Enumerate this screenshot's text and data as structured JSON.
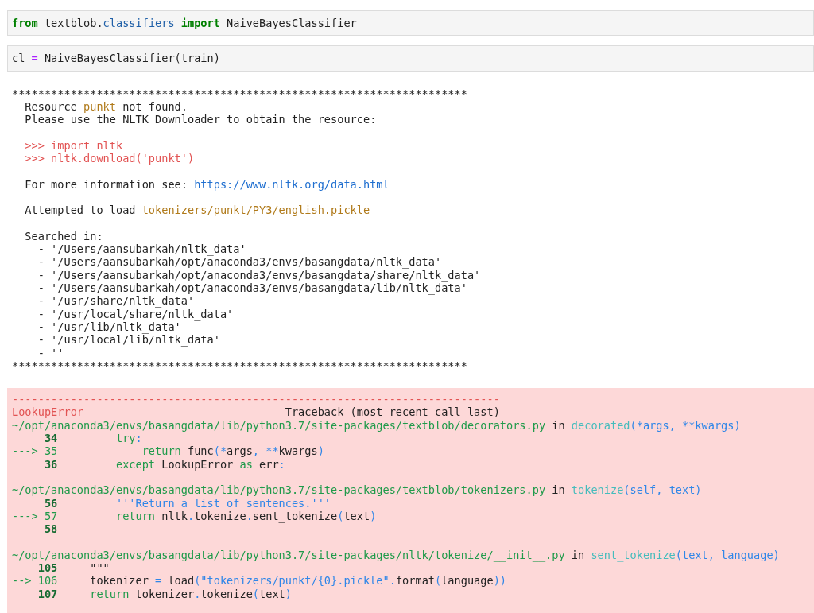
{
  "cells": [
    {
      "kind": "input",
      "lines": [
        {
          "kind": "code",
          "tokens": [
            {
              "text": "from",
              "kind": "keyword"
            },
            {
              "text": " textblob.",
              "kind": "plain"
            },
            {
              "text": "classifiers",
              "kind": "module"
            },
            {
              "text": " import",
              "kind": "keyword"
            },
            {
              "text": " NaiveBayesClassifier",
              "kind": "plain"
            }
          ]
        }
      ]
    },
    {
      "kind": "input",
      "lines": [
        {
          "kind": "code",
          "tokens": [
            {
              "text": "cl ",
              "kind": "plain"
            },
            {
              "text": "=",
              "kind": "operator"
            },
            {
              "text": " NaiveBayesClassifier(train)",
              "kind": "plain"
            }
          ]
        }
      ]
    },
    {
      "kind": "output",
      "lines": [
        {
          "kind": "code",
          "tokens": [
            {
              "text": "**********************************************************************",
              "kind": "plain"
            }
          ]
        },
        {
          "kind": "code",
          "tokens": [
            {
              "text": "  Resource ",
              "kind": "plain"
            },
            {
              "text": "punkt",
              "kind": "string"
            },
            {
              "text": " not found.",
              "kind": "plain"
            }
          ]
        },
        {
          "kind": "code",
          "tokens": [
            {
              "text": "  Please use the NLTK Downloader to obtain the resource:",
              "kind": "plain"
            }
          ]
        },
        {
          "kind": "blank"
        },
        {
          "kind": "code",
          "tokens": [
            {
              "text": "  >>> import nltk",
              "kind": "red"
            }
          ]
        },
        {
          "kind": "code",
          "tokens": [
            {
              "text": "  >>> nltk.download('punkt')",
              "kind": "red"
            }
          ]
        },
        {
          "kind": "blank"
        },
        {
          "kind": "code",
          "tokens": [
            {
              "text": "  For more information see: ",
              "kind": "plain"
            },
            {
              "text": "https://www.nltk.org/data.html",
              "kind": "link"
            }
          ]
        },
        {
          "kind": "blank"
        },
        {
          "kind": "code",
          "tokens": [
            {
              "text": "  Attempted to load ",
              "kind": "plain"
            },
            {
              "text": "tokenizers/punkt/PY3/english.pickle",
              "kind": "string"
            }
          ]
        },
        {
          "kind": "blank"
        },
        {
          "kind": "code",
          "tokens": [
            {
              "text": "  Searched in:",
              "kind": "plain"
            }
          ]
        },
        {
          "kind": "code",
          "tokens": [
            {
              "text": "    - '/Users/aansubarkah/nltk_data'",
              "kind": "plain"
            }
          ]
        },
        {
          "kind": "code",
          "tokens": [
            {
              "text": "    - '/Users/aansubarkah/opt/anaconda3/envs/basangdata/nltk_data'",
              "kind": "plain"
            }
          ]
        },
        {
          "kind": "code",
          "tokens": [
            {
              "text": "    - '/Users/aansubarkah/opt/anaconda3/envs/basangdata/share/nltk_data'",
              "kind": "plain"
            }
          ]
        },
        {
          "kind": "code",
          "tokens": [
            {
              "text": "    - '/Users/aansubarkah/opt/anaconda3/envs/basangdata/lib/nltk_data'",
              "kind": "plain"
            }
          ]
        },
        {
          "kind": "code",
          "tokens": [
            {
              "text": "    - '/usr/share/nltk_data'",
              "kind": "plain"
            }
          ]
        },
        {
          "kind": "code",
          "tokens": [
            {
              "text": "    - '/usr/local/share/nltk_data'",
              "kind": "plain"
            }
          ]
        },
        {
          "kind": "code",
          "tokens": [
            {
              "text": "    - '/usr/lib/nltk_data'",
              "kind": "plain"
            }
          ]
        },
        {
          "kind": "code",
          "tokens": [
            {
              "text": "    - '/usr/local/lib/nltk_data'",
              "kind": "plain"
            }
          ]
        },
        {
          "kind": "code",
          "tokens": [
            {
              "text": "    - ''",
              "kind": "plain"
            }
          ]
        },
        {
          "kind": "code",
          "tokens": [
            {
              "text": "**********************************************************************",
              "kind": "plain"
            }
          ]
        }
      ]
    },
    {
      "kind": "error",
      "lines": [
        {
          "kind": "code",
          "tokens": [
            {
              "text": "---------------------------------------------------------------------------",
              "kind": "red"
            }
          ]
        },
        {
          "kind": "code",
          "tokens": [
            {
              "text": "LookupError",
              "kind": "red"
            },
            {
              "text": "                               Traceback (most recent call last)",
              "kind": "plain"
            }
          ]
        },
        {
          "kind": "code",
          "tokens": [
            {
              "text": "~/opt/anaconda3/envs/basangdata/lib/python3.7/site-packages/textblob/decorators.py",
              "kind": "path"
            },
            {
              "text": " in ",
              "kind": "plain"
            },
            {
              "text": "decorated",
              "kind": "function"
            },
            {
              "text": "(*args, **kwargs)",
              "kind": "param"
            }
          ]
        },
        {
          "kind": "code",
          "tokens": [
            {
              "text": "     34",
              "kind": "lineno"
            },
            {
              "text": "         try",
              "kind": "path"
            },
            {
              "text": ":",
              "kind": "param"
            }
          ]
        },
        {
          "kind": "code",
          "tokens": [
            {
              "text": "---> 35",
              "kind": "path"
            },
            {
              "text": "             return",
              "kind": "path"
            },
            {
              "text": " func",
              "kind": "plain"
            },
            {
              "text": "(*",
              "kind": "param"
            },
            {
              "text": "args",
              "kind": "plain"
            },
            {
              "text": ", **",
              "kind": "param"
            },
            {
              "text": "kwargs",
              "kind": "plain"
            },
            {
              "text": ")",
              "kind": "param"
            }
          ]
        },
        {
          "kind": "code",
          "tokens": [
            {
              "text": "     36",
              "kind": "lineno"
            },
            {
              "text": "         except",
              "kind": "path"
            },
            {
              "text": " LookupError ",
              "kind": "plain"
            },
            {
              "text": "as",
              "kind": "path"
            },
            {
              "text": " err",
              "kind": "plain"
            },
            {
              "text": ":",
              "kind": "param"
            }
          ]
        },
        {
          "kind": "blank"
        },
        {
          "kind": "code",
          "tokens": [
            {
              "text": "~/opt/anaconda3/envs/basangdata/lib/python3.7/site-packages/textblob/tokenizers.py",
              "kind": "path"
            },
            {
              "text": " in ",
              "kind": "plain"
            },
            {
              "text": "tokenize",
              "kind": "function"
            },
            {
              "text": "(self, text)",
              "kind": "param"
            }
          ]
        },
        {
          "kind": "code",
          "tokens": [
            {
              "text": "     56",
              "kind": "lineno"
            },
            {
              "text": "         '''Return a list of sentences.'''",
              "kind": "param"
            }
          ]
        },
        {
          "kind": "code",
          "tokens": [
            {
              "text": "---> 57",
              "kind": "path"
            },
            {
              "text": "         return",
              "kind": "path"
            },
            {
              "text": " nltk",
              "kind": "plain"
            },
            {
              "text": ".",
              "kind": "param"
            },
            {
              "text": "tokenize",
              "kind": "plain"
            },
            {
              "text": ".",
              "kind": "param"
            },
            {
              "text": "sent_tokenize",
              "kind": "plain"
            },
            {
              "text": "(",
              "kind": "param"
            },
            {
              "text": "text",
              "kind": "plain"
            },
            {
              "text": ")",
              "kind": "param"
            }
          ]
        },
        {
          "kind": "code",
          "tokens": [
            {
              "text": "     58",
              "kind": "lineno"
            }
          ]
        },
        {
          "kind": "blank"
        },
        {
          "kind": "code",
          "tokens": [
            {
              "text": "~/opt/anaconda3/envs/basangdata/lib/python3.7/site-packages/nltk/tokenize/__init__.py",
              "kind": "path"
            },
            {
              "text": " in ",
              "kind": "plain"
            },
            {
              "text": "sent_tokenize",
              "kind": "function"
            },
            {
              "text": "(text, language)",
              "kind": "param"
            }
          ]
        },
        {
          "kind": "code",
          "tokens": [
            {
              "text": "    105",
              "kind": "lineno"
            },
            {
              "text": "     \"\"\"",
              "kind": "plain"
            }
          ]
        },
        {
          "kind": "code",
          "tokens": [
            {
              "text": "--> 106",
              "kind": "path"
            },
            {
              "text": "     tokenizer ",
              "kind": "plain"
            },
            {
              "text": "=",
              "kind": "param"
            },
            {
              "text": " load",
              "kind": "plain"
            },
            {
              "text": "(\"tokenizers/punkt/{0}.pickle\".",
              "kind": "param"
            },
            {
              "text": "format",
              "kind": "plain"
            },
            {
              "text": "(",
              "kind": "param"
            },
            {
              "text": "language",
              "kind": "plain"
            },
            {
              "text": "))",
              "kind": "param"
            }
          ]
        },
        {
          "kind": "code",
          "tokens": [
            {
              "text": "    107",
              "kind": "lineno"
            },
            {
              "text": "     return",
              "kind": "path"
            },
            {
              "text": " tokenizer",
              "kind": "plain"
            },
            {
              "text": ".",
              "kind": "param"
            },
            {
              "text": "tokenize",
              "kind": "plain"
            },
            {
              "text": "(",
              "kind": "param"
            },
            {
              "text": "text",
              "kind": "plain"
            },
            {
              "text": ")",
              "kind": "param"
            }
          ]
        }
      ]
    }
  ]
}
